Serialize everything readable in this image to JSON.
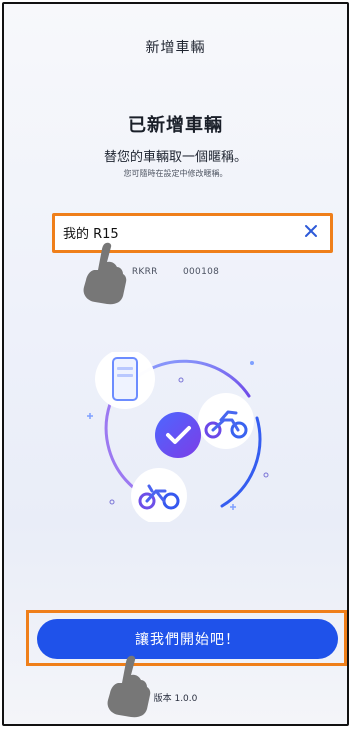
{
  "header": {
    "title": "新增車輛"
  },
  "hero": {
    "title": "已新增車輛",
    "subtitle": "替您的車輛取一個暱稱。",
    "note": "您可隨時在設定中修改暱稱。"
  },
  "nickname": {
    "value": "我的 R15",
    "clear_icon": "close-icon"
  },
  "vehicle": {
    "vin_masked": "RKRR        000108"
  },
  "cta": {
    "label": "讓我們開始吧！"
  },
  "footer": {
    "version": "版本 1.0.0"
  },
  "colors": {
    "accent": "#1f52ea",
    "highlight": "#ef7f1a",
    "background": "#eef1fa"
  }
}
